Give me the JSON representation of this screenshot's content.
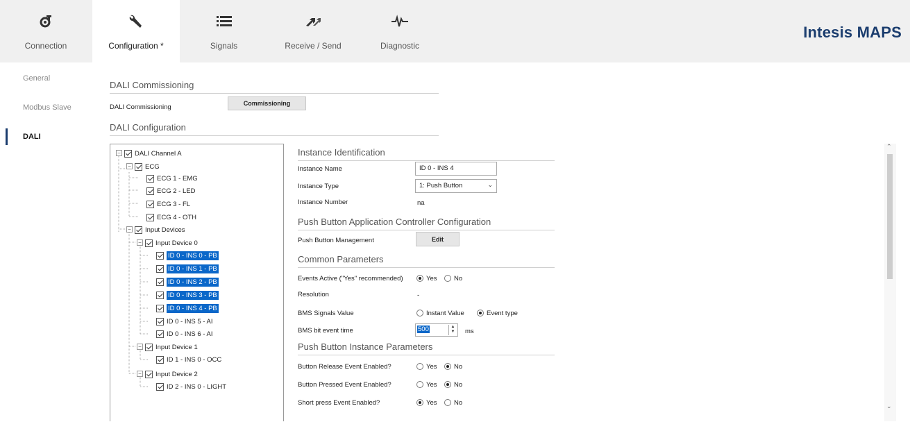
{
  "tabs": [
    {
      "label": "Connection",
      "icon": "connection-icon",
      "active": false
    },
    {
      "label": "Configuration *",
      "icon": "wrench-icon",
      "active": true
    },
    {
      "label": "Signals",
      "icon": "list-icon",
      "active": false
    },
    {
      "label": "Receive / Send",
      "icon": "receive-send-icon",
      "active": false
    },
    {
      "label": "Diagnostic",
      "icon": "pulse-icon",
      "active": false
    }
  ],
  "brand": "Intesis MAPS",
  "leftnav": {
    "general": "General",
    "modbus": "Modbus Slave",
    "dali": "DALI"
  },
  "commissioning": {
    "section_title": "DALI Commissioning",
    "row_label": "DALI Commissioning",
    "button_label": "Commissioning"
  },
  "configuration": {
    "section_title": "DALI Configuration"
  },
  "tree": {
    "channel": "DALI Channel A",
    "ecg": "ECG",
    "ecg_items": [
      "ECG 1 - EMG",
      "ECG 2 - LED",
      "ECG 3 - FL",
      "ECG 4 - OTH"
    ],
    "input_devices": "Input Devices",
    "device0": "Input Device 0",
    "device0_items": [
      "ID 0 - INS 0 - PB",
      "ID 0 - INS 1 - PB",
      "ID 0 - INS 2 - PB",
      "ID 0 - INS 3 - PB",
      "ID 0 - INS 4 - PB",
      "ID 0 - INS 5 - AI",
      "ID 0 - INS 6 - AI"
    ],
    "device1": "Input Device 1",
    "device1_items": [
      "ID 1 - INS 0 - OCC"
    ],
    "device2": "Input Device 2",
    "device2_items": [
      "ID 2 - INS 0 - LIGHT"
    ]
  },
  "instance": {
    "section_title": "Instance Identification",
    "name_label": "Instance Name",
    "name_value": "ID 0 - INS 4",
    "type_label": "Instance Type",
    "type_value": "1: Push Button",
    "number_label": "Instance Number",
    "number_value": "na"
  },
  "pbac": {
    "section_title": "Push Button Application Controller Configuration",
    "management_label": "Push Button Management",
    "edit_label": "Edit"
  },
  "common": {
    "section_title": "Common Parameters",
    "events_label": "Events Active (\"Yes\" recommended)",
    "yes": "Yes",
    "no": "No",
    "resolution_label": "Resolution",
    "resolution_value": "-",
    "bms_label": "BMS Signals Value",
    "instant": "Instant Value",
    "event_type": "Event type",
    "bit_time_label": "BMS bit event time",
    "bit_time_value": "500",
    "bit_time_unit": "ms"
  },
  "pbinst": {
    "section_title": "Push Button Instance Parameters",
    "release_label": "Button Release Event Enabled?",
    "pressed_label": "Button Pressed Event Enabled?",
    "short_label": "Short press Event Enabled?",
    "yes": "Yes",
    "no": "No"
  }
}
